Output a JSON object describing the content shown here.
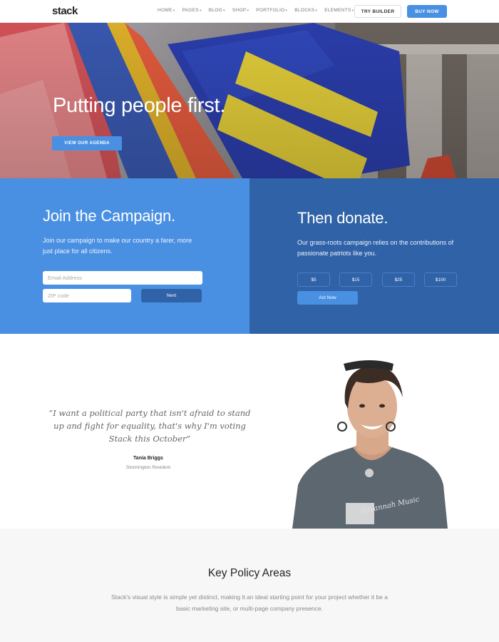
{
  "nav": {
    "logo": "stack",
    "menu": [
      "HOME",
      "PAGES",
      "BLOG",
      "SHOP",
      "PORTFOLIO",
      "BLOCKS",
      "ELEMENTS"
    ],
    "try_builder": "TRY BUILDER",
    "buy_now": "BUY NOW"
  },
  "hero": {
    "title": "Putting people first.",
    "button": "VIEW OUR AGENDA"
  },
  "join": {
    "title": "Join the Campaign.",
    "text": "Join our campaign to make our country a farer, more just place for all citizens.",
    "email_placeholder": "Email Address",
    "zip_placeholder": "ZIP code",
    "next": "Next"
  },
  "donate": {
    "title": "Then donate.",
    "text": "Our grass-roots campaign relies on the contributions of passionate patriots like you.",
    "amounts": [
      "$5",
      "$15",
      "$25",
      "$100"
    ],
    "act": "Act Now"
  },
  "testimonial": {
    "quote": "“I want a political party that isn't afraid to stand up and fight for equality, that's why I'm voting Stack this October”",
    "author": "Tania Briggs",
    "role": "Stonnington Resident",
    "shirt_text": "Savannah Music"
  },
  "policy": {
    "title": "Key Policy Areas",
    "text": "Stack's visual style is simple yet distinct, making it an ideal starting point for your project whether it be a basic marketing site, or multi-page company presence."
  },
  "colors": {
    "accent": "#4a90e2",
    "accent_dark": "#2f62a7"
  }
}
